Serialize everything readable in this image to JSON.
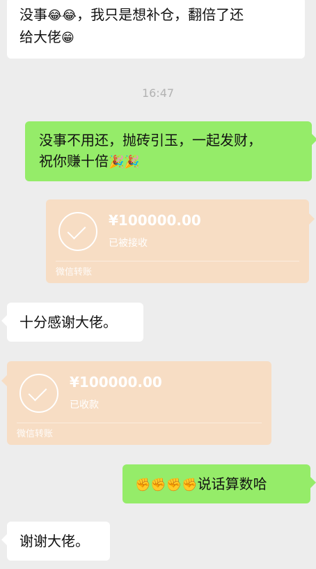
{
  "messages": {
    "m1": {
      "line1_a": "没事",
      "line1_emoji": "😂😂",
      "line1_b": "，我只是想补仓，翻倍了还",
      "line2": "给大佬",
      "line2_emoji": "😁"
    },
    "time": "16:47",
    "m2": {
      "line1": "没事不用还，抛砖引玉，一起发财，",
      "line2": "祝你赚十倍",
      "line2_emoji": "🎉🎉"
    },
    "transfer1": {
      "amount": "¥100000.00",
      "status": "已被接收",
      "footer": "微信转账"
    },
    "m3": {
      "text": "十分感谢大佬。"
    },
    "transfer2": {
      "amount": "¥100000.00",
      "status": "已收款",
      "footer": "微信转账"
    },
    "m4": {
      "emoji": "✊✊✊✊",
      "text": "说话算数哈"
    },
    "m5": {
      "text": "谢谢大佬。"
    }
  }
}
